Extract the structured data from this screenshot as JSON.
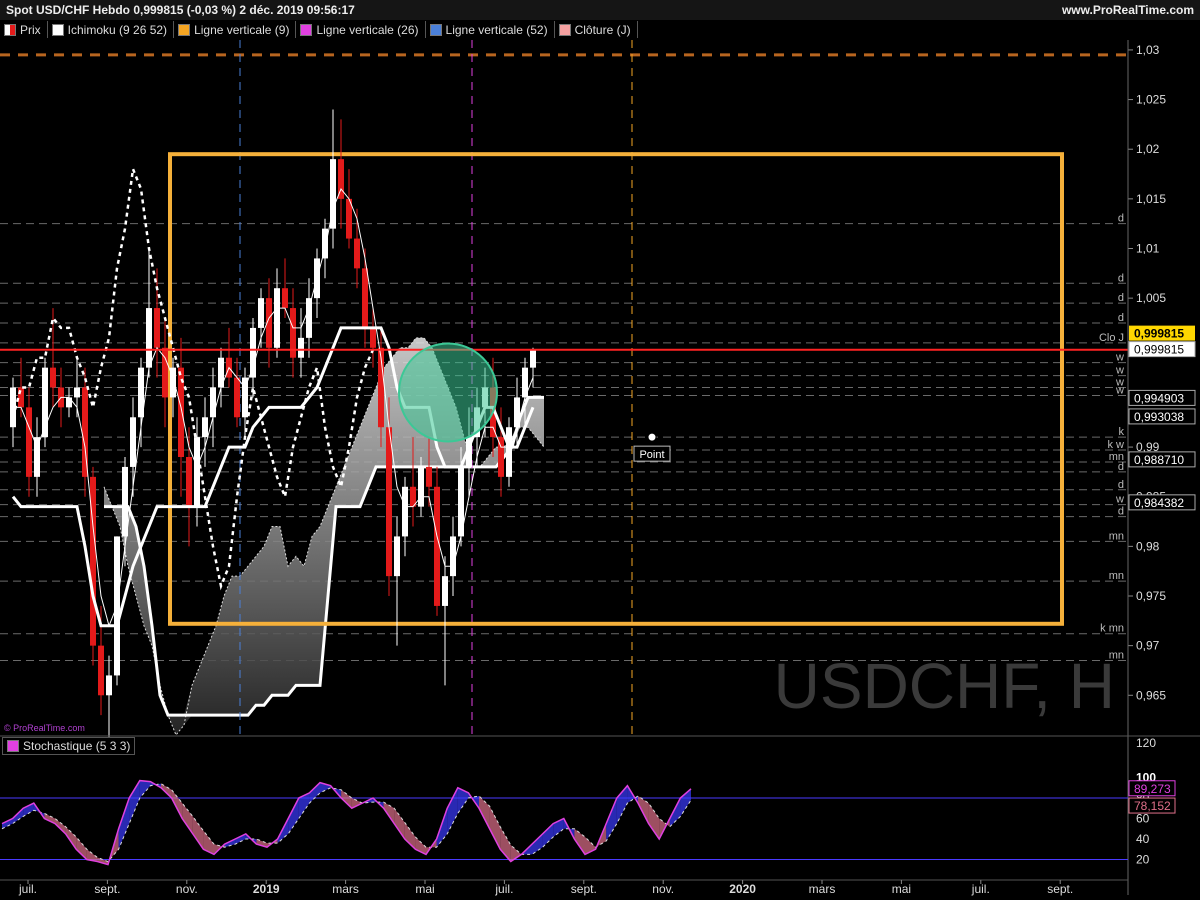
{
  "header": {
    "title": "Spot USD/CHF Hebdo 0,999815 (-0,03 %) 2 déc. 2019 09:56:17",
    "brand": "www.ProRealTime.com"
  },
  "legend": [
    {
      "label": "Prix",
      "color": "#e31a1a",
      "swatch": "prix"
    },
    {
      "label": "Ichimoku (9 26 52)",
      "color": "#ffffff",
      "swatch": "plain"
    },
    {
      "label": "Ligne verticale (9)",
      "color": "#f5a623",
      "swatch": "plain"
    },
    {
      "label": "Ligne verticale (26)",
      "color": "#e040e0",
      "swatch": "plain"
    },
    {
      "label": "Ligne verticale (52)",
      "color": "#4a7fd8",
      "swatch": "plain"
    },
    {
      "label": "Clôture (J)",
      "color": "#f4a0a0",
      "swatch": "plain"
    }
  ],
  "watermark": "USDCHF, H",
  "small_brand": "© ProRealTime.com",
  "point_label": "Point",
  "chart_data": [
    {
      "type": "candlestick",
      "title": "Spot USD/CHF Hebdo",
      "ylim": [
        0.961,
        1.031
      ],
      "y_ticks": [
        "1,03",
        "1,025",
        "1,02",
        "1,015",
        "1,01",
        "1,005",
        "1",
        "0,995",
        "0,99",
        "0,985",
        "0,98",
        "0,975",
        "0,97",
        "0,965"
      ],
      "x_tick_labels": [
        "juil.",
        "sept.",
        "nov.",
        "2019",
        "mars",
        "mai",
        "juil.",
        "sept.",
        "nov.",
        "2020",
        "mars",
        "mai",
        "juil.",
        "sept."
      ],
      "current_price": {
        "value": 0.999815,
        "label": "0,999815",
        "color": "#ffd700"
      },
      "price_labels": [
        "0,999815",
        "0,994903",
        "0,993038",
        "0,988710",
        "0,984382"
      ],
      "price_label_values": [
        0.999815,
        0.994903,
        0.993038,
        0.98871,
        0.984382
      ],
      "level_labels": [
        "d",
        "d",
        "d",
        "d",
        "Clo J",
        "w",
        "w",
        "w",
        "w",
        "k",
        "k w",
        "mn",
        "d",
        "d",
        "w",
        "d",
        "mn",
        "mn",
        "k mn",
        "mn"
      ],
      "level_values": [
        1.0125,
        1.0065,
        1.0045,
        1.0025,
        1.0005,
        0.9985,
        0.9972,
        0.996,
        0.9952,
        0.991,
        0.9897,
        0.9885,
        0.9875,
        0.9857,
        0.9842,
        0.983,
        0.9805,
        0.9765,
        0.9712,
        0.9685
      ],
      "close_line": 0.9998,
      "levels_dashed": [
        1.0295
      ],
      "rectangle": {
        "y_top": 1.0195,
        "y_bottom": 0.9722
      },
      "vertical_lines": [
        {
          "name": "Ligne verticale (52)",
          "color": "#4a7fd8",
          "x_index": 29
        },
        {
          "name": "Ligne verticale (26)",
          "color": "#e040e0",
          "x_index": 58
        },
        {
          "name": "Ligne verticale (9)",
          "color": "#f5a623",
          "x_index": 78
        }
      ],
      "candles": [
        [
          0.992,
          0.997,
          0.99,
          0.996
        ],
        [
          0.996,
          0.999,
          0.993,
          0.994
        ],
        [
          0.994,
          0.996,
          0.985,
          0.987
        ],
        [
          0.987,
          0.993,
          0.985,
          0.991
        ],
        [
          0.991,
          0.999,
          0.99,
          0.998
        ],
        [
          0.998,
          1.004,
          0.994,
          0.996
        ],
        [
          0.996,
          0.998,
          0.992,
          0.994
        ],
        [
          0.994,
          0.996,
          0.993,
          0.995
        ],
        [
          0.995,
          0.999,
          0.993,
          0.996
        ],
        [
          0.996,
          0.998,
          0.985,
          0.987
        ],
        [
          0.987,
          0.988,
          0.968,
          0.97
        ],
        [
          0.97,
          0.974,
          0.963,
          0.965
        ],
        [
          0.965,
          0.969,
          0.96,
          0.967
        ],
        [
          0.967,
          0.981,
          0.966,
          0.981
        ],
        [
          0.981,
          0.989,
          0.978,
          0.988
        ],
        [
          0.988,
          0.995,
          0.985,
          0.993
        ],
        [
          0.993,
          0.999,
          0.99,
          0.998
        ],
        [
          0.998,
          1.01,
          0.997,
          1.004
        ],
        [
          1.004,
          1.008,
          0.997,
          1.0
        ],
        [
          1.0,
          1.003,
          0.992,
          0.995
        ],
        [
          0.995,
          0.999,
          0.993,
          0.998
        ],
        [
          0.998,
          1.001,
          0.985,
          0.989
        ],
        [
          0.989,
          0.992,
          0.98,
          0.984
        ],
        [
          0.984,
          0.993,
          0.982,
          0.991
        ],
        [
          0.991,
          0.995,
          0.988,
          0.993
        ],
        [
          0.993,
          0.998,
          0.99,
          0.996
        ],
        [
          0.996,
          1.0,
          0.994,
          0.999
        ],
        [
          0.999,
          1.002,
          0.996,
          0.997
        ],
        [
          0.997,
          0.999,
          0.992,
          0.993
        ],
        [
          0.993,
          0.998,
          0.991,
          0.997
        ],
        [
          0.997,
          1.003,
          0.995,
          1.002
        ],
        [
          1.002,
          1.006,
          1.0,
          1.005
        ],
        [
          1.005,
          1.007,
          0.998,
          1.0
        ],
        [
          1.0,
          1.008,
          0.999,
          1.006
        ],
        [
          1.006,
          1.009,
          1.003,
          1.004
        ],
        [
          1.004,
          1.006,
          0.997,
          0.999
        ],
        [
          0.999,
          1.004,
          0.997,
          1.001
        ],
        [
          1.001,
          1.007,
          0.999,
          1.005
        ],
        [
          1.005,
          1.01,
          1.003,
          1.009
        ],
        [
          1.009,
          1.013,
          1.007,
          1.012
        ],
        [
          1.012,
          1.024,
          1.01,
          1.019
        ],
        [
          1.019,
          1.023,
          1.012,
          1.015
        ],
        [
          1.015,
          1.018,
          1.01,
          1.011
        ],
        [
          1.011,
          1.014,
          1.006,
          1.008
        ],
        [
          1.008,
          1.01,
          1.0,
          1.002
        ],
        [
          1.002,
          1.004,
          0.998,
          1.0
        ],
        [
          1.0,
          1.002,
          0.99,
          0.992
        ],
        [
          0.992,
          0.995,
          0.975,
          0.977
        ],
        [
          0.977,
          0.983,
          0.97,
          0.981
        ],
        [
          0.981,
          0.987,
          0.979,
          0.986
        ],
        [
          0.986,
          0.991,
          0.982,
          0.984
        ],
        [
          0.984,
          0.989,
          0.983,
          0.988
        ],
        [
          0.988,
          0.991,
          0.984,
          0.986
        ],
        [
          0.986,
          0.988,
          0.973,
          0.974
        ],
        [
          0.974,
          0.979,
          0.966,
          0.977
        ],
        [
          0.977,
          0.983,
          0.975,
          0.981
        ],
        [
          0.981,
          0.99,
          0.98,
          0.988
        ],
        [
          0.988,
          0.994,
          0.985,
          0.991
        ],
        [
          0.991,
          0.996,
          0.988,
          0.994
        ],
        [
          0.994,
          0.998,
          0.991,
          0.996
        ],
        [
          0.996,
          0.999,
          0.989,
          0.991
        ],
        [
          0.991,
          0.994,
          0.985,
          0.987
        ],
        [
          0.987,
          0.993,
          0.986,
          0.992
        ],
        [
          0.992,
          0.997,
          0.99,
          0.995
        ],
        [
          0.995,
          0.999,
          0.992,
          0.998
        ],
        [
          0.998,
          1.0,
          0.996,
          0.9998
        ]
      ],
      "tenkan": [
        0.994,
        0.994,
        0.992,
        0.99,
        0.992,
        0.994,
        0.995,
        0.995,
        0.994,
        0.99,
        0.982,
        0.975,
        0.972,
        0.974,
        0.98,
        0.986,
        0.992,
        0.998,
        1.0,
        0.999,
        0.997,
        0.994,
        0.99,
        0.988,
        0.99,
        0.993,
        0.996,
        0.998,
        0.997,
        0.996,
        0.998,
        1.001,
        1.003,
        1.004,
        1.004,
        1.002,
        1.002,
        1.004,
        1.007,
        1.01,
        1.014,
        1.016,
        1.015,
        1.013,
        1.009,
        1.004,
        0.999,
        0.992,
        0.986,
        0.984,
        0.984,
        0.985,
        0.985,
        0.981,
        0.978,
        0.978,
        0.981,
        0.985,
        0.989,
        0.992,
        0.992,
        0.99,
        0.99,
        0.992,
        0.995,
        0.997
      ],
      "kijun": [
        0.985,
        0.984,
        0.984,
        0.984,
        0.984,
        0.984,
        0.984,
        0.984,
        0.984,
        0.98,
        0.975,
        0.972,
        0.972,
        0.972,
        0.975,
        0.978,
        0.98,
        0.982,
        0.984,
        0.984,
        0.984,
        0.984,
        0.984,
        0.984,
        0.984,
        0.986,
        0.988,
        0.99,
        0.99,
        0.99,
        0.992,
        0.993,
        0.994,
        0.994,
        0.994,
        0.994,
        0.994,
        0.995,
        0.996,
        0.998,
        1.0,
        1.002,
        1.002,
        1.002,
        1.002,
        1.002,
        1.002,
        1.0,
        0.996,
        0.994,
        0.994,
        0.994,
        0.994,
        0.99,
        0.988,
        0.988,
        0.988,
        0.99,
        0.992,
        0.994,
        0.994,
        0.992,
        0.99,
        0.99,
        0.992,
        0.994
      ],
      "chikou": [
        0.993,
        0.996,
        0.996,
        0.999,
        0.999,
        1.003,
        1.002,
        1.002,
        0.999,
        0.997,
        0.994,
        0.998,
        1.001,
        1.008,
        1.012,
        1.018,
        1.016,
        1.01,
        1.006,
        1.003,
        1.0,
        0.997,
        0.995,
        0.99,
        0.985,
        0.98,
        0.976,
        0.978,
        0.985,
        0.991,
        0.996,
        0.993,
        0.99,
        0.987,
        0.985,
        0.99,
        0.993,
        0.996,
        0.998,
        0.992,
        0.988,
        0.986,
        0.99,
        0.995,
        0.998,
        0.9998
      ],
      "ssa": [
        0.986,
        0.984,
        0.982,
        0.978,
        0.975,
        0.972,
        0.97,
        0.966,
        0.963,
        0.961,
        0.962,
        0.966,
        0.968,
        0.97,
        0.972,
        0.975,
        0.977,
        0.977,
        0.978,
        0.979,
        0.98,
        0.982,
        0.982,
        0.978,
        0.979,
        0.978,
        0.981,
        0.982,
        0.984,
        0.986,
        0.988,
        0.99,
        0.992,
        0.994,
        0.996,
        0.998,
        0.999,
        1.0,
        1.0,
        1.001,
        1.001,
        1.0,
        0.998,
        0.996,
        0.994,
        0.991,
        0.988,
        0.988,
        0.989,
        0.99,
        0.99,
        0.991,
        0.992,
        0.992,
        0.991,
        0.99
      ],
      "ssb": [
        0.984,
        0.984,
        0.984,
        0.984,
        0.982,
        0.978,
        0.972,
        0.965,
        0.963,
        0.963,
        0.963,
        0.963,
        0.963,
        0.963,
        0.963,
        0.963,
        0.963,
        0.963,
        0.963,
        0.964,
        0.964,
        0.965,
        0.965,
        0.965,
        0.966,
        0.966,
        0.966,
        0.966,
        0.975,
        0.984,
        0.984,
        0.984,
        0.984,
        0.986,
        0.988,
        0.988,
        0.988,
        0.988,
        0.988,
        0.988,
        0.988,
        0.988,
        0.988,
        0.988,
        0.988,
        0.988,
        0.988,
        0.988,
        0.988,
        0.988,
        0.989,
        0.99,
        0.993,
        0.995,
        0.995,
        0.995
      ]
    },
    {
      "type": "line",
      "title": "Stochastique (5 3 3)",
      "ylim": [
        0,
        120
      ],
      "y_ticks": [
        "120",
        "100",
        "80",
        "60",
        "40",
        "20"
      ],
      "levels": [
        80,
        20
      ],
      "last_values": {
        "k": "89,273",
        "d": "78,152"
      },
      "k": [
        55,
        60,
        70,
        75,
        60,
        55,
        45,
        30,
        20,
        18,
        15,
        50,
        80,
        97,
        96,
        90,
        80,
        60,
        45,
        30,
        25,
        35,
        40,
        45,
        35,
        32,
        40,
        60,
        80,
        85,
        95,
        92,
        80,
        70,
        75,
        80,
        70,
        55,
        40,
        30,
        25,
        40,
        70,
        90,
        85,
        70,
        50,
        30,
        18,
        25,
        35,
        45,
        55,
        60,
        40,
        25,
        30,
        55,
        80,
        92,
        75,
        55,
        40,
        60,
        80,
        89
      ],
      "d": [
        50,
        55,
        62,
        68,
        65,
        60,
        52,
        42,
        30,
        22,
        18,
        30,
        55,
        80,
        92,
        94,
        88,
        75,
        62,
        48,
        35,
        32,
        35,
        40,
        40,
        36,
        36,
        45,
        60,
        75,
        85,
        90,
        88,
        80,
        75,
        76,
        76,
        70,
        56,
        42,
        32,
        32,
        45,
        65,
        80,
        82,
        72,
        52,
        34,
        25,
        25,
        32,
        42,
        50,
        50,
        42,
        32,
        38,
        55,
        75,
        82,
        75,
        60,
        52,
        62,
        78
      ]
    }
  ]
}
